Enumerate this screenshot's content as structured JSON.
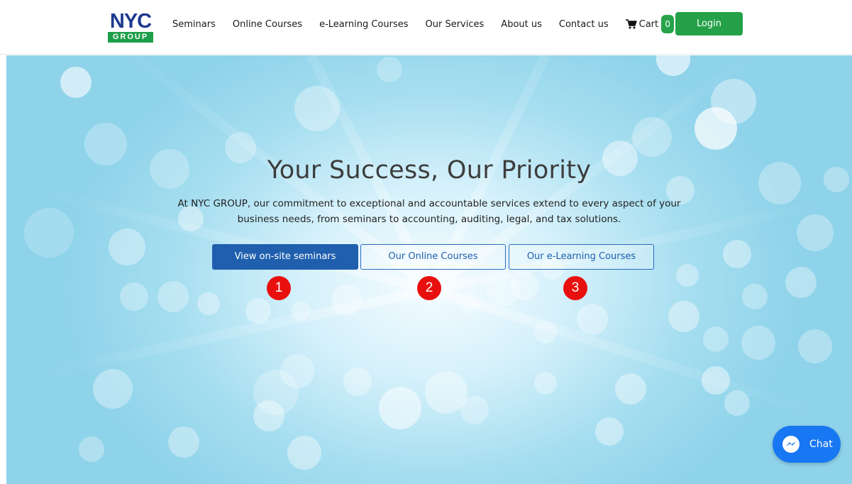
{
  "header": {
    "logo": {
      "top": "NYC",
      "bottom": "GROUP"
    },
    "nav": [
      {
        "label": "Seminars"
      },
      {
        "label": "Online Courses"
      },
      {
        "label": "e-Learning Courses"
      },
      {
        "label": "Our Services"
      },
      {
        "label": "About us"
      },
      {
        "label": "Contact us"
      }
    ],
    "cart": {
      "label": "Cart",
      "count": "0",
      "icon": "cart-icon"
    },
    "login_label": "Login"
  },
  "hero": {
    "title": "Your Success, Our Priority",
    "description": "At NYC GROUP, our commitment to exceptional and accountable services extend to every aspect of your business needs, from seminars to accounting, auditing, legal, and tax solutions.",
    "buttons": [
      {
        "label": "View on-site seminars"
      },
      {
        "label": "Our Online Courses"
      },
      {
        "label": "Our e-Learning Courses"
      }
    ],
    "markers": [
      "1",
      "2",
      "3"
    ]
  },
  "chat": {
    "label": "Chat",
    "icon": "messenger-icon"
  },
  "colors": {
    "brand_blue": "#1f3a8f",
    "brand_green": "#1e9e4a",
    "primary_button": "#1f5fae",
    "login_green": "#24a148",
    "marker_red": "#e8100f",
    "chat_blue": "#1877f2"
  }
}
